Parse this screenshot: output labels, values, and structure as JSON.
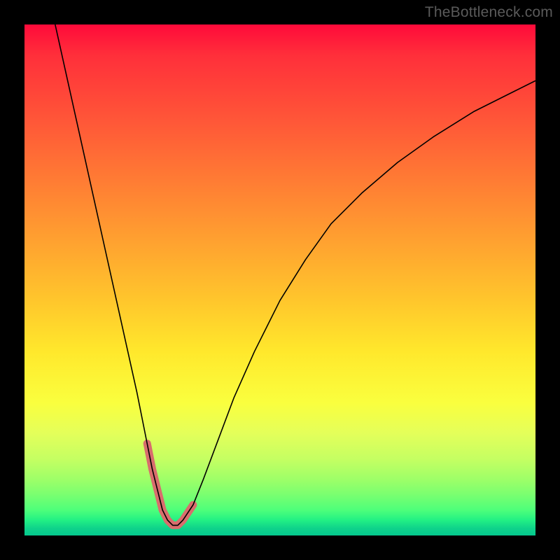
{
  "watermark": {
    "text": "TheBottleneck.com"
  },
  "chart_data": {
    "type": "line",
    "title": "",
    "xlabel": "",
    "ylabel": "",
    "xlim": [
      0,
      100
    ],
    "ylim": [
      0,
      100
    ],
    "series": [
      {
        "name": "main-curve",
        "color": "#000000",
        "width": 1.6,
        "x": [
          6,
          8,
          10,
          12,
          14,
          16,
          18,
          20,
          22,
          24,
          25,
          26,
          27,
          28,
          29,
          30,
          31,
          33,
          35,
          38,
          41,
          45,
          50,
          55,
          60,
          66,
          73,
          80,
          88,
          96,
          100
        ],
        "y": [
          100,
          91,
          82,
          73,
          64,
          55,
          46,
          37,
          28,
          18,
          13,
          9,
          5,
          3,
          2,
          2,
          3,
          6,
          11,
          19,
          27,
          36,
          46,
          54,
          61,
          67,
          73,
          78,
          83,
          87,
          89
        ]
      },
      {
        "name": "highlight-zone",
        "color": "#d86d6d",
        "width": 11,
        "linecap": "round",
        "x": [
          24,
          25,
          26,
          27,
          28,
          29,
          30,
          31,
          33
        ],
        "y": [
          18,
          13,
          9,
          5,
          3,
          2,
          2,
          3,
          6
        ]
      }
    ]
  }
}
